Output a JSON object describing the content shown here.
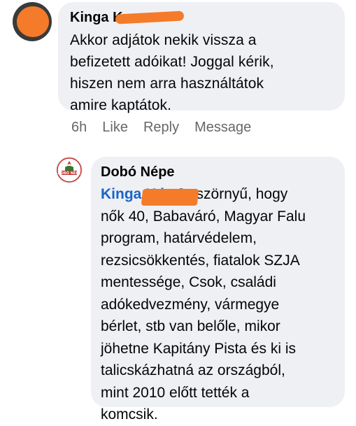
{
  "comment": {
    "author": "Kinga K",
    "text": "Akkor adjátok nekik vissza a\nbefizetett adóikat! Joggal kérik,\nhiszen nem arra használtátok\namire kaptátok.",
    "time": "6h",
    "like_label": "Like",
    "reply_label": "Reply",
    "message_label": "Message"
  },
  "reply": {
    "author": "Dobó Népe",
    "avatar_text": "DOBÓ NÉPE",
    "mention": "Kinga K is",
    "lines": [
      " Ja szörnyű, hogy",
      "nők 40, Babaváró, Magyar Falu",
      "program, határvédelem,",
      "rezsicsökkentés, fiatalok SZJA",
      "mentessége, Csok, családi",
      "adókedvezmény, vármegye",
      "bérlet, stb van belőle, mikor",
      "jöhetne Kapitány Pista és ki is",
      "talicskázhatná az országból,",
      "mint 2010 előtt tették a",
      "komcsik."
    ]
  },
  "colors": {
    "bubble": "#eff0f4",
    "mention": "#1a63c6",
    "meta": "#65676b",
    "redaction": "#f47b2a"
  }
}
